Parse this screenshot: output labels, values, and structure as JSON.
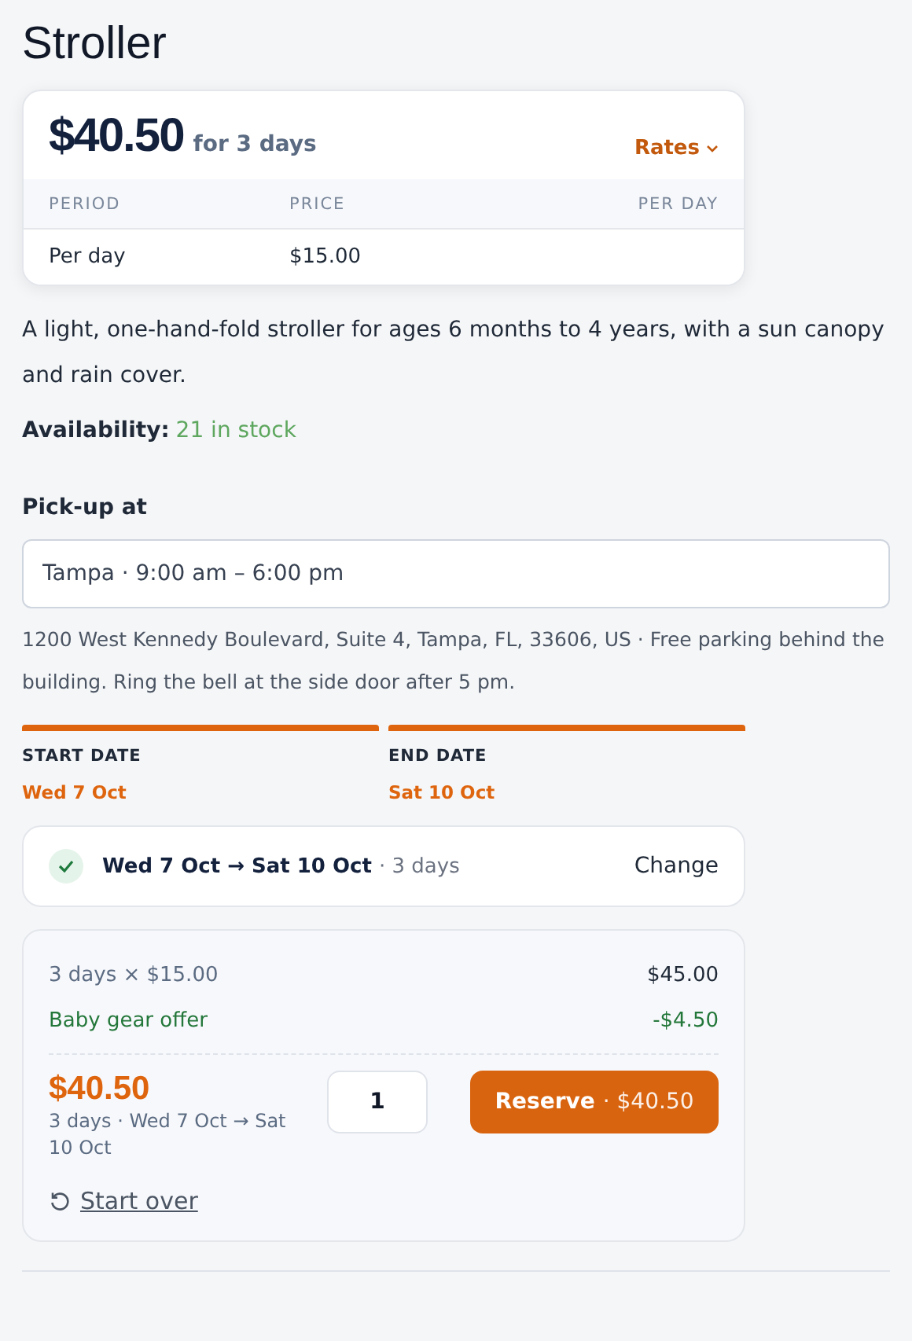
{
  "title": "Stroller",
  "price_card": {
    "price": "$40.50",
    "duration": "for 3 days",
    "rates_toggle": "Rates",
    "columns": [
      "PERIOD",
      "PRICE",
      "PER DAY"
    ],
    "rows": [
      {
        "period": "Per day",
        "price": "$15.00"
      }
    ]
  },
  "description": "A light, one-hand-fold stroller for ages 6 months to 4 years, with a sun canopy and rain cover.",
  "availability": {
    "label": "Availability:",
    "value": "21 in stock"
  },
  "pickup": {
    "label": "Pick-up at",
    "value": "Tampa · 9:00 am – 6:00 pm",
    "address": "1200 West Kennedy Boulevard, Suite 4, Tampa, FL, 33606, US · Free parking behind the building. Ring the bell at the side door after 5 pm."
  },
  "dates": [
    {
      "label": "START DATE",
      "value": "Wed 7 Oct"
    },
    {
      "label": "END DATE",
      "value": "Sat 10 Oct"
    }
  ],
  "summary": {
    "range": "Wed 7 Oct → Sat 10 Oct",
    "days": "· 3 days",
    "change": "Change"
  },
  "breakdown": {
    "lines": [
      {
        "kind": "charge",
        "label": "3 days × $15.00",
        "amount": "$45.00"
      },
      {
        "kind": "discount",
        "label": "Baby gear offer",
        "amount": "-$4.50"
      }
    ],
    "total": "$40.50",
    "total_detail": "3 days · Wed 7 Oct → Sat 10 Oct",
    "quantity": "1",
    "reserve": "Reserve",
    "reserve_price": "· $40.50",
    "start_over": "Start over"
  }
}
